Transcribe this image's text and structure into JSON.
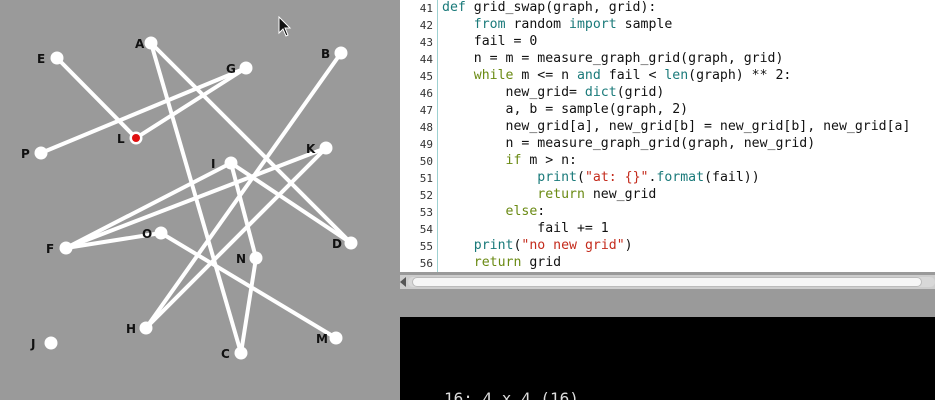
{
  "graph": {
    "nodes": [
      {
        "id": "A",
        "label": "A",
        "highlight": false
      },
      {
        "id": "B",
        "label": "B",
        "highlight": false
      },
      {
        "id": "C",
        "label": "C",
        "highlight": false
      },
      {
        "id": "D",
        "label": "D",
        "highlight": false
      },
      {
        "id": "E",
        "label": "E",
        "highlight": false
      },
      {
        "id": "F",
        "label": "F",
        "highlight": false
      },
      {
        "id": "G",
        "label": "G",
        "highlight": false
      },
      {
        "id": "H",
        "label": "H",
        "highlight": false
      },
      {
        "id": "I",
        "label": "I",
        "highlight": false
      },
      {
        "id": "J",
        "label": "J",
        "highlight": false
      },
      {
        "id": "K",
        "label": "K",
        "highlight": false
      },
      {
        "id": "L",
        "label": "L",
        "highlight": true
      },
      {
        "id": "M",
        "label": "M",
        "highlight": false
      },
      {
        "id": "N",
        "label": "N",
        "highlight": false
      },
      {
        "id": "O",
        "label": "O",
        "highlight": false
      },
      {
        "id": "P",
        "label": "P",
        "highlight": false
      }
    ],
    "edges": [
      [
        "E",
        "L"
      ],
      [
        "L",
        "G"
      ],
      [
        "P",
        "G"
      ],
      [
        "A",
        "D"
      ],
      [
        "A",
        "C"
      ],
      [
        "B",
        "H"
      ],
      [
        "K",
        "F"
      ],
      [
        "I",
        "F"
      ],
      [
        "I",
        "D"
      ],
      [
        "I",
        "N"
      ],
      [
        "N",
        "C"
      ],
      [
        "O",
        "F"
      ],
      [
        "O",
        "M"
      ],
      [
        "K",
        "H"
      ]
    ],
    "highlight_color": "#e01010",
    "node_color": "#ffffff",
    "panel_bg": "#9a9a9a"
  },
  "editor": {
    "lines": [
      {
        "n": "41",
        "tokens": [
          {
            "t": "def ",
            "c": "bi"
          },
          {
            "t": "grid_swap(graph, grid):",
            "c": ""
          }
        ]
      },
      {
        "n": "42",
        "tokens": [
          {
            "t": "    "
          },
          {
            "t": "from ",
            "c": "kw"
          },
          {
            "t": "random ",
            "c": ""
          },
          {
            "t": "import ",
            "c": "kw"
          },
          {
            "t": "sample",
            "c": ""
          }
        ]
      },
      {
        "n": "43",
        "tokens": [
          {
            "t": "    fail = 0",
            "c": ""
          }
        ]
      },
      {
        "n": "44",
        "tokens": [
          {
            "t": "    n = m = measure_graph_grid(graph, grid)",
            "c": ""
          }
        ]
      },
      {
        "n": "45",
        "tokens": [
          {
            "t": "    "
          },
          {
            "t": "while ",
            "c": "kw2"
          },
          {
            "t": "m <= n ",
            "c": ""
          },
          {
            "t": "and ",
            "c": "kw"
          },
          {
            "t": "fail < ",
            "c": ""
          },
          {
            "t": "len",
            "c": "bi"
          },
          {
            "t": "(graph) ** 2:",
            "c": ""
          }
        ]
      },
      {
        "n": "46",
        "tokens": [
          {
            "t": "        new_grid= "
          },
          {
            "t": "dict",
            "c": "bi"
          },
          {
            "t": "(grid)",
            "c": ""
          }
        ]
      },
      {
        "n": "47",
        "tokens": [
          {
            "t": "        a, b = sample(graph, 2)",
            "c": ""
          }
        ]
      },
      {
        "n": "48",
        "tokens": [
          {
            "t": "        new_grid[a], new_grid[b] = new_grid[b], new_grid[a]",
            "c": ""
          }
        ]
      },
      {
        "n": "49",
        "tokens": [
          {
            "t": "        n = measure_graph_grid(graph, new_grid)",
            "c": ""
          }
        ]
      },
      {
        "n": "50",
        "tokens": [
          {
            "t": "        "
          },
          {
            "t": "if ",
            "c": "kw2"
          },
          {
            "t": "m > n:",
            "c": ""
          }
        ]
      },
      {
        "n": "51",
        "tokens": [
          {
            "t": "            "
          },
          {
            "t": "print",
            "c": "bi"
          },
          {
            "t": "(",
            "c": ""
          },
          {
            "t": "\"at: {}\"",
            "c": "str"
          },
          {
            "t": ".",
            "c": ""
          },
          {
            "t": "format",
            "c": "bi"
          },
          {
            "t": "(fail))",
            "c": ""
          }
        ]
      },
      {
        "n": "52",
        "tokens": [
          {
            "t": "            "
          },
          {
            "t": "return ",
            "c": "kw2"
          },
          {
            "t": "new_grid",
            "c": ""
          }
        ]
      },
      {
        "n": "53",
        "tokens": [
          {
            "t": "        "
          },
          {
            "t": "else",
            "c": "kw2"
          },
          {
            "t": ":",
            "c": ""
          }
        ]
      },
      {
        "n": "54",
        "tokens": [
          {
            "t": "            fail += 1",
            "c": ""
          }
        ]
      },
      {
        "n": "55",
        "tokens": [
          {
            "t": "    "
          },
          {
            "t": "print",
            "c": "bi"
          },
          {
            "t": "(",
            "c": ""
          },
          {
            "t": "\"no new grid\"",
            "c": "str"
          },
          {
            "t": ")",
            "c": ""
          }
        ]
      },
      {
        "n": "56",
        "tokens": [
          {
            "t": "    "
          },
          {
            "t": "return ",
            "c": "kw2"
          },
          {
            "t": "grid",
            "c": ""
          }
        ]
      }
    ]
  },
  "terminal": {
    "text": "16: 4 x 4 (16)"
  }
}
